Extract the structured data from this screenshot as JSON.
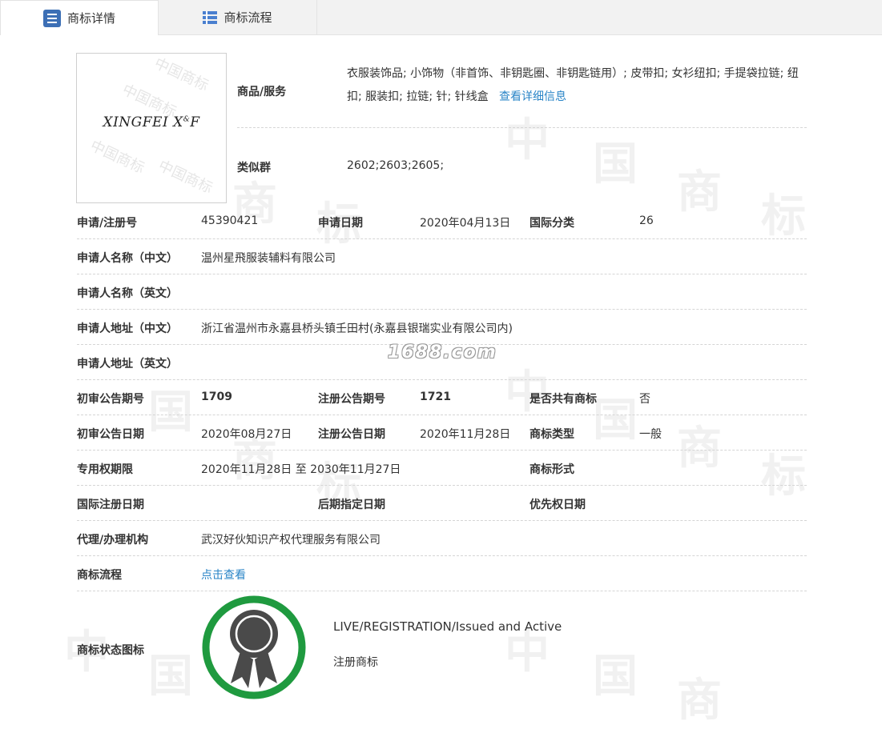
{
  "tabs": [
    {
      "label": "商标详情",
      "active": true,
      "icon": "list-icon"
    },
    {
      "label": "商标流程",
      "active": false,
      "icon": "grid-list-icon"
    }
  ],
  "logo": {
    "text_main": "XINGFEI  X",
    "text_sup": "&",
    "text_end": "F",
    "watermark": "中国商标"
  },
  "goods": {
    "label": "商品/服务",
    "text": "衣服装饰品; 小饰物（非首饰、非钥匙圈、非钥匙链用）; 皮带扣; 女衫纽扣; 手提袋拉链; 纽扣; 服装扣; 拉链; 针; 针线盒",
    "link": "查看详细信息"
  },
  "similar": {
    "label": "类似群",
    "value": "2602;2603;2605;"
  },
  "rows": {
    "reg_no": {
      "label": "申请/注册号",
      "value": "45390421"
    },
    "apply_date": {
      "label": "申请日期",
      "value": "2020年04月13日"
    },
    "intl_class": {
      "label": "国际分类",
      "value": "26"
    },
    "applicant_cn": {
      "label": "申请人名称（中文）",
      "value": "温州星飛服装辅料有限公司"
    },
    "applicant_en": {
      "label": "申请人名称（英文）",
      "value": ""
    },
    "address_cn": {
      "label": "申请人地址（中文）",
      "value": "浙江省温州市永嘉县桥头镇壬田村(永嘉县银瑞实业有限公司内)"
    },
    "address_en": {
      "label": "申请人地址（英文）",
      "value": ""
    },
    "prelim_no": {
      "label": "初审公告期号",
      "value": "1709"
    },
    "reg_pub_no": {
      "label": "注册公告期号",
      "value": "1721"
    },
    "shared": {
      "label": "是否共有商标",
      "value": "否"
    },
    "prelim_date": {
      "label": "初审公告日期",
      "value": "2020年08月27日"
    },
    "reg_pub_date": {
      "label": "注册公告日期",
      "value": "2020年11月28日"
    },
    "mark_type": {
      "label": "商标类型",
      "value": "一般"
    },
    "exclusive": {
      "label": "专用权期限",
      "value": "2020年11月28日 至 2030年11月27日"
    },
    "mark_form": {
      "label": "商标形式",
      "value": ""
    },
    "intl_reg_date": {
      "label": "国际注册日期",
      "value": ""
    },
    "later_date": {
      "label": "后期指定日期",
      "value": ""
    },
    "priority_date": {
      "label": "优先权日期",
      "value": ""
    },
    "agent": {
      "label": "代理/办理机构",
      "value": "武汉好伙知识产权代理服务有限公司"
    },
    "flow": {
      "label": "商标流程",
      "value": "点击查看"
    }
  },
  "status": {
    "label": "商标状态图标",
    "en": "LIVE/REGISTRATION/Issued and Active",
    "cn": "注册商标",
    "icon": "registered-badge-icon",
    "ring_color": "#1f9a3f",
    "badge_color": "#4a4a4a"
  },
  "watermark_text": "1688.com",
  "bg_watermark": [
    "中",
    "国",
    "商",
    "标"
  ]
}
